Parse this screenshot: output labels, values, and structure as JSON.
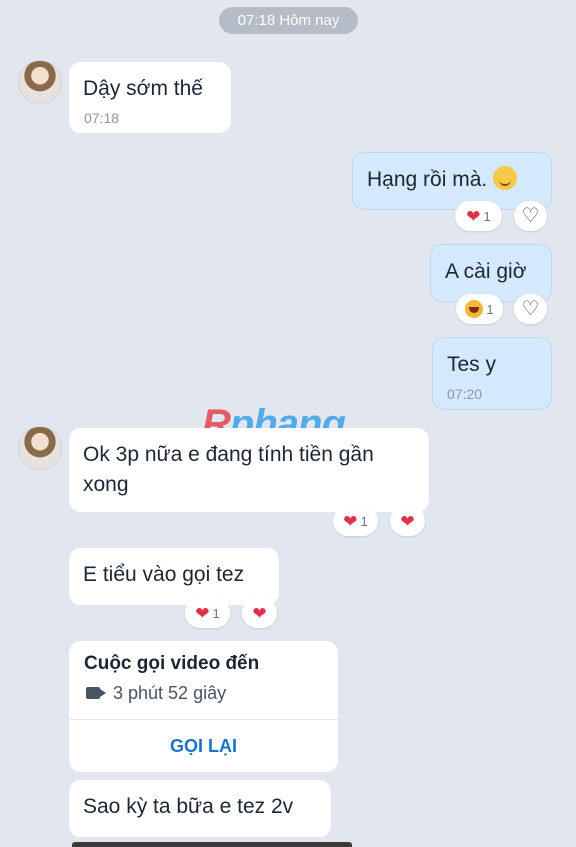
{
  "date_pill": "07:18 Hôm nay",
  "watermark": {
    "r": "R",
    "rest": "phang"
  },
  "messages": [
    {
      "text": "Dậy sớm thế",
      "time": "07:18"
    },
    {
      "text": "Hạng rồi mà.",
      "emoji": "relieved-face"
    },
    {
      "text": "A cài giờ"
    },
    {
      "text": "Tes y",
      "time": "07:20"
    },
    {
      "text": "Ok 3p nữa e đang tính tiền gần xong"
    },
    {
      "text": "E tiểu vào gọi tez"
    },
    {
      "text": "Sao kỳ ta bữa e tez 2v"
    }
  ],
  "reactions": {
    "heart_count": "1",
    "haha_count": "1",
    "heart_glyph": "❤",
    "heart_outline_glyph": "♡"
  },
  "call": {
    "title": "Cuộc gọi video đến",
    "duration": "3 phút 52 giây",
    "callback_label": "GỌI LẠI"
  },
  "colors": {
    "background": "#e2e6ee",
    "incoming_bubble": "#ffffff",
    "outgoing_bubble": "#d4e9fb",
    "heart": "#e0314b",
    "link": "#1a73c8"
  }
}
